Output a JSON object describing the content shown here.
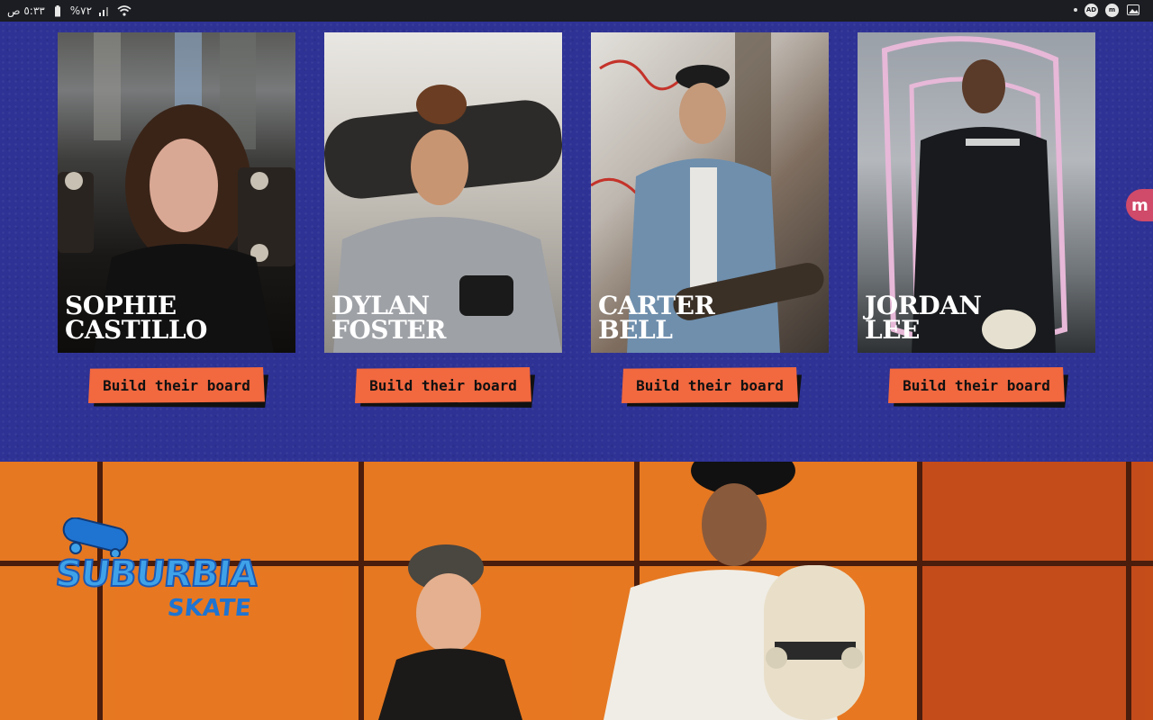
{
  "status_bar": {
    "time": "٥:٣٣ ص",
    "battery": "%٧٢",
    "right_icons": [
      "dot-icon",
      "ad-badge-icon",
      "m-app-icon",
      "image-icon"
    ]
  },
  "team": {
    "members": [
      {
        "first": "Sophie",
        "last": "Castillo",
        "button": "Build their board"
      },
      {
        "first": "Dylan",
        "last": "Foster",
        "button": "Build their board"
      },
      {
        "first": "Carter",
        "last": "Bell",
        "button": "Build their board"
      },
      {
        "first": "Jordan",
        "last": "Lee",
        "button": "Build their board"
      }
    ]
  },
  "side_bubble": {
    "label": "m"
  },
  "brand": {
    "line1": "SUBURBIA",
    "line2": "SKATE"
  },
  "colors": {
    "team_bg": "#2e3295",
    "button": "#f2683f",
    "hero_bg": "#e06b1a",
    "logo_blue": "#3fa2e8"
  }
}
